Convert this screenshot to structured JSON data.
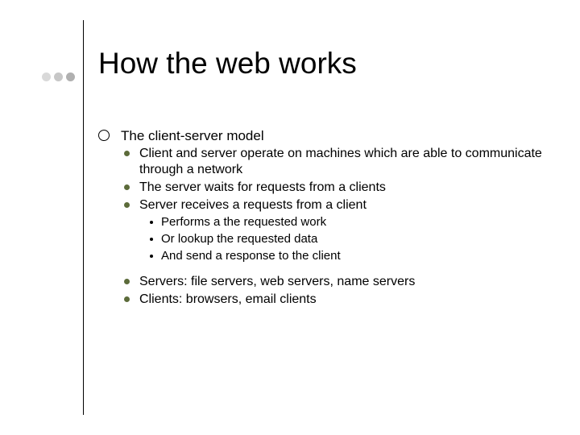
{
  "title": "How the web works",
  "body": {
    "l1": [
      "The client-server model"
    ],
    "l2a": [
      "Client and server operate on machines which are able to communicate through a network",
      "The server waits for requests from a clients",
      "Server receives a requests from a client"
    ],
    "l3": [
      "Performs a the requested work",
      "Or lookup the requested data",
      "And send a response to the client"
    ],
    "l2b": [
      "Servers: file servers, web servers, name servers",
      "Clients: browsers, email clients"
    ]
  }
}
